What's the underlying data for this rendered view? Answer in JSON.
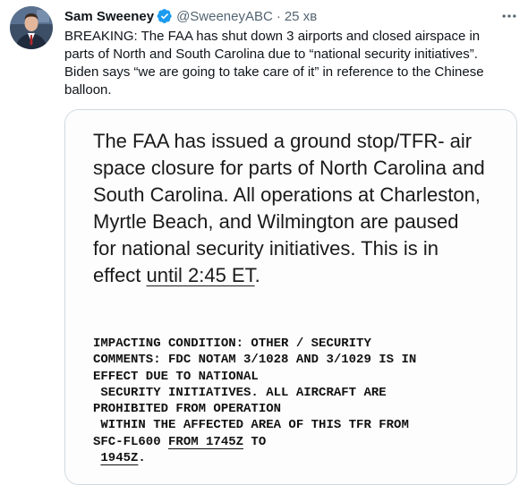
{
  "tweet": {
    "author": {
      "display_name": "Sam Sweeney",
      "handle": "@SweeneyABC",
      "verified": true,
      "avatar_icon": "profile-photo"
    },
    "separator": "·",
    "time": "25 хв",
    "more_icon": "more-horizontal-icon",
    "text_lines": [
      "BREAKING: The FAA has shut down 3 airports and closed airspace in",
      "parts of North and South Carolina due to “national security initiatives”.",
      "Biden says “we are going to take care of it” in reference to the Chinese",
      "balloon."
    ],
    "media": {
      "notice_lines": [
        "The FAA has issued a ground stop/TFR- air",
        "space closure for parts of North Carolina and",
        "South Carolina. All operations at Charleston,",
        "Myrtle Beach, and Wilmington are paused",
        "for national security initiatives. This is in"
      ],
      "notice_last_prefix": "effect ",
      "notice_last_underlined": "until 2:45 ET",
      "notice_last_suffix": ".",
      "notam_lines": [
        "IMPACTING CONDITION: OTHER / SECURITY",
        "COMMENTS: FDC NOTAM 3/1028 AND 3/1029 IS IN",
        "EFFECT DUE TO NATIONAL",
        " SECURITY INITIATIVES. ALL AIRCRAFT ARE",
        "PROHIBITED FROM OPERATION",
        " WITHIN THE AFFECTED AREA OF THIS TFR FROM"
      ],
      "notam_line7_prefix": "SFC-FL600 ",
      "notam_line7_underlined": "FROM 1745Z",
      "notam_line7_suffix": " TO",
      "notam_line8_prefix": " ",
      "notam_line8_underlined": "1945Z",
      "notam_line8_suffix": "."
    },
    "colors": {
      "text": "#0f1419",
      "secondary": "#536471",
      "verified_blue": "#1d9bf0",
      "border": "#cfd9de"
    }
  }
}
